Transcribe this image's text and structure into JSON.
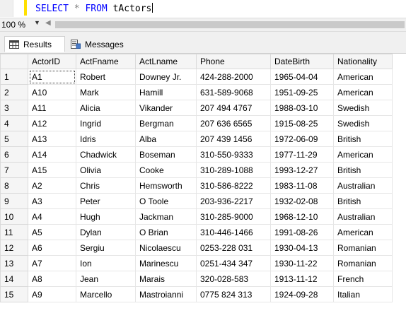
{
  "editor": {
    "keyword_select": "SELECT",
    "star": "*",
    "keyword_from": "FROM",
    "table_name": "tActors"
  },
  "zoom": {
    "value": "100 %"
  },
  "tabs": [
    {
      "label": "Results",
      "icon": "grid-icon",
      "active": true
    },
    {
      "label": "Messages",
      "icon": "messages-icon",
      "active": false
    }
  ],
  "grid": {
    "columns": [
      "ActorID",
      "ActFname",
      "ActLname",
      "Phone",
      "DateBirth",
      "Nationality"
    ],
    "rows": [
      [
        "1",
        "A1",
        "Robert",
        "Downey Jr.",
        "424-288-2000",
        "1965-04-04",
        "American"
      ],
      [
        "2",
        "A10",
        "Mark",
        "Hamill",
        "631-589-9068",
        "1951-09-25",
        "American"
      ],
      [
        "3",
        "A11",
        "Alicia",
        "Vikander",
        "207 494 4767",
        "1988-03-10",
        "Swedish"
      ],
      [
        "4",
        "A12",
        "Ingrid",
        "Bergman",
        "207 636 6565",
        "1915-08-25",
        "Swedish"
      ],
      [
        "5",
        "A13",
        "Idris",
        "Alba",
        "207 439 1456",
        "1972-06-09",
        "British"
      ],
      [
        "6",
        "A14",
        "Chadwick",
        "Boseman",
        "310-550-9333",
        "1977-11-29",
        "American"
      ],
      [
        "7",
        "A15",
        "Olivia",
        "Cooke",
        "310-289-1088",
        "1993-12-27",
        "British"
      ],
      [
        "8",
        "A2",
        "Chris",
        "Hemsworth",
        "310-586-8222",
        "1983-11-08",
        "Australian"
      ],
      [
        "9",
        "A3",
        "Peter",
        "O Toole",
        "203-936-2217",
        "1932-02-08",
        "British"
      ],
      [
        "10",
        "A4",
        "Hugh",
        "Jackman",
        "310-285-9000",
        "1968-12-10",
        "Australian"
      ],
      [
        "11",
        "A5",
        "Dylan",
        "O Brian",
        "310-446-1466",
        "1991-08-26",
        "American"
      ],
      [
        "12",
        "A6",
        "Sergiu",
        "Nicolaescu",
        "0253-228 031",
        "1930-04-13",
        "Romanian"
      ],
      [
        "13",
        "A7",
        "Ion",
        "Marinescu",
        "0251-434 347",
        "1930-11-22",
        "Romanian"
      ],
      [
        "14",
        "A8",
        "Jean",
        "Marais",
        "320-028-583",
        "1913-11-12",
        "French"
      ],
      [
        "15",
        "A9",
        "Marcello",
        "Mastroianni",
        "0775 824 313",
        "1924-09-28",
        "Italian"
      ]
    ]
  }
}
